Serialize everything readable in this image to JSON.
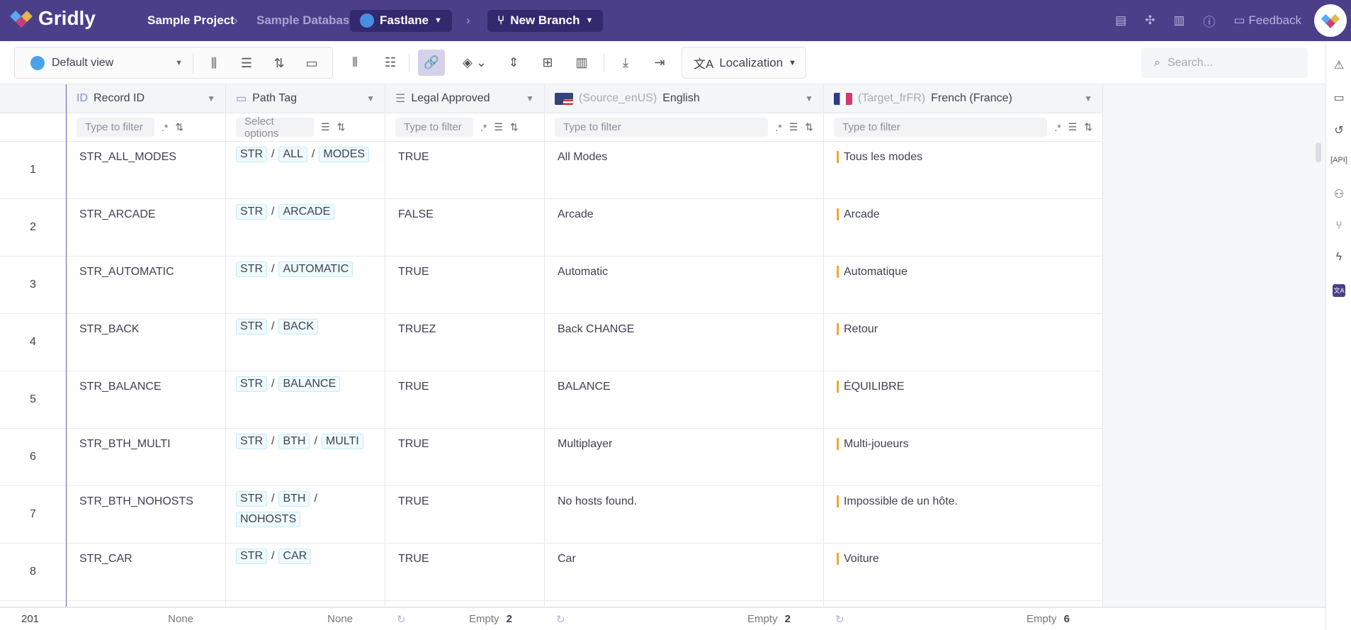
{
  "header": {
    "brand": "Gridly",
    "project": "Sample Project",
    "database": "Sample Database",
    "grid": "Fastlane",
    "branch": "New Branch",
    "feedback": "Feedback"
  },
  "toolbar": {
    "view": "Default view",
    "localization": "Localization",
    "search_placeholder": "Search..."
  },
  "columns": [
    {
      "label": "Record ID",
      "icon": "ID",
      "filter": "Type to filter",
      "footer": "None"
    },
    {
      "label": "Path Tag",
      "filter": "Select options",
      "footer": "None"
    },
    {
      "label": "Legal Approved",
      "filter": "Type to filter",
      "footer_label": "Empty",
      "footer_count": "2"
    },
    {
      "prefix": "(Source_enUS)",
      "label": "English",
      "filter": "Type to filter",
      "footer_label": "Empty",
      "footer_count": "2"
    },
    {
      "prefix": "(Target_frFR)",
      "label": "French (France)",
      "filter": "Type to filter",
      "footer_label": "Empty",
      "footer_count": "6"
    }
  ],
  "row_count": "201",
  "rows": [
    {
      "n": "1",
      "id": "STR_ALL_MODES",
      "path": [
        "STR",
        "ALL",
        "MODES"
      ],
      "legal": "TRUE",
      "en": "All Modes",
      "fr": "Tous les modes"
    },
    {
      "n": "2",
      "id": "STR_ARCADE",
      "path": [
        "STR",
        "ARCADE"
      ],
      "legal": "FALSE",
      "en": "Arcade",
      "fr": "Arcade"
    },
    {
      "n": "3",
      "id": "STR_AUTOMATIC",
      "path": [
        "STR",
        "AUTOMATIC"
      ],
      "legal": "TRUE",
      "en": "Automatic",
      "fr": "Automatique"
    },
    {
      "n": "4",
      "id": "STR_BACK",
      "path": [
        "STR",
        "BACK"
      ],
      "legal": "TRUEZ",
      "en": "Back CHANGE",
      "fr": "Retour"
    },
    {
      "n": "5",
      "id": "STR_BALANCE",
      "path": [
        "STR",
        "BALANCE"
      ],
      "legal": "TRUE",
      "en": "BALANCE",
      "fr": "ÉQUILIBRE"
    },
    {
      "n": "6",
      "id": "STR_BTH_MULTI",
      "path": [
        "STR",
        "BTH",
        "MULTI"
      ],
      "legal": "TRUE",
      "en": "Multiplayer",
      "fr": "Multi-joueurs"
    },
    {
      "n": "7",
      "id": "STR_BTH_NOHOSTS",
      "path": [
        "STR",
        "BTH",
        "NOHOSTS"
      ],
      "legal": "TRUE",
      "en": "No hosts found.",
      "fr": "Impossible de un hôte."
    },
    {
      "n": "8",
      "id": "STR_CAR",
      "path": [
        "STR",
        "CAR"
      ],
      "legal": "TRUE",
      "en": "Car",
      "fr": "Voiture"
    }
  ],
  "colors": {
    "brand": "#4b3f8a",
    "accent": "#f0a830"
  }
}
